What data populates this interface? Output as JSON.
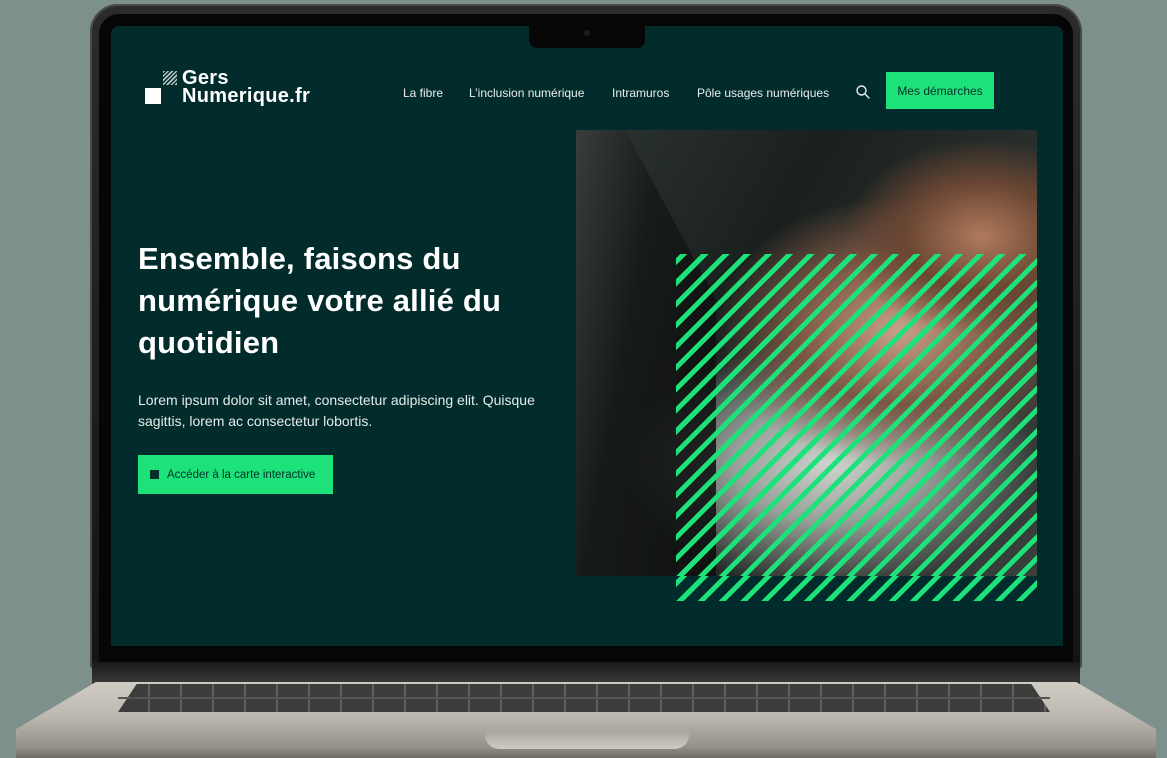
{
  "site": {
    "logo": {
      "line1": "Gers",
      "line2": "Numerique.fr"
    },
    "nav": {
      "items": [
        {
          "label": "La fibre"
        },
        {
          "label": "L’inclusion numérique"
        },
        {
          "label": "Intramuros"
        },
        {
          "label": "Pôle usages numériques"
        }
      ],
      "search_icon": "search-icon",
      "cta_label": "Mes démarches"
    },
    "hero": {
      "title": "Ensemble, faisons du numérique votre allié du quotidien",
      "lead": "Lorem ipsum dolor sit amet, consectetur adipiscing elit. Quisque sagittis, lorem ac consectetur lobortis.",
      "cta_label": "Accéder à la carte interactive",
      "cta_icon": "square-icon"
    }
  },
  "colors": {
    "background": "#022c2b",
    "accent": "#1de27a",
    "text": "#ffffff",
    "page_backdrop": "#7e908c"
  }
}
